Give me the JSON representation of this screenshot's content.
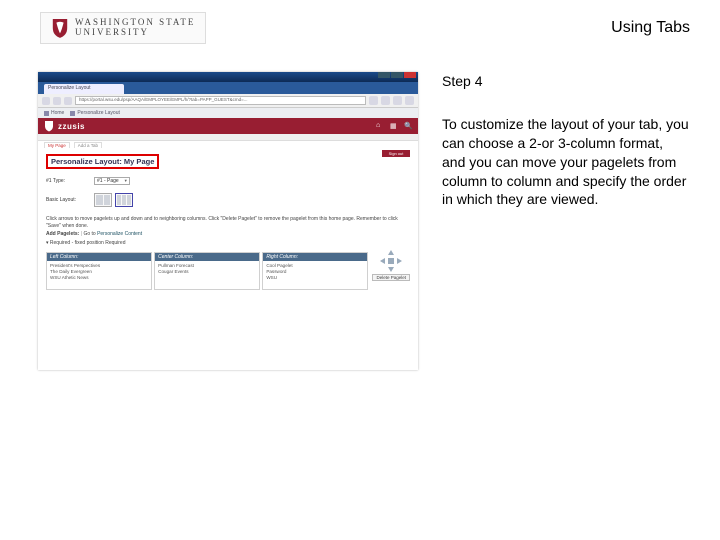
{
  "header": {
    "uni_line1": "WASHINGTON STATE",
    "uni_line2": "UNIVERSITY",
    "page_title": "Using Tabs"
  },
  "instruction": {
    "step": "Step 4",
    "body": "To customize the layout of your tab, you can choose a 2-or 3-column format, and you can move your pagelets from column to column and specify the order in which they are viewed."
  },
  "shot": {
    "browser_tab": "Personalize Layout",
    "url": "https://portal.wsu.edu/psp/AAQA/EMPLOYEE/EMPL/h/?tab=PAPP_GUEST&cmd=...",
    "bookmark1": "Home",
    "bookmark2": "Personalize Layout",
    "brand": "zzusis",
    "signout": "Sign out",
    "nav_tab1": "My Page",
    "nav_tab2": "Add a Tab",
    "heading": "Personalize Layout: My Page",
    "lbl_type": "#1  Type:",
    "val_type": "#1 - Page",
    "lbl_layout": "Basic Layout:",
    "blurb1": "Click arrows to move pagelets up and down and to neighboring columns. Click \"Delete Pagelet\" to remove the pagelet from this home page. Remember to click \"Save\" when done.",
    "blurb2_lead": "Add Pagelets:",
    "blurb2_go": "Go to",
    "blurb2_link": "Personalize Content",
    "blurb3": "▾  Required - fixed position  Required",
    "col1_h": "Left Column:",
    "col2_h": "Center Column:",
    "col3_h": "Right Column:",
    "col1_items": [
      "President's Perspectives",
      "The Daily Evergreen",
      "WSU Athetic News"
    ],
    "col2_items": [
      "Pullman Forecast",
      "Cougar Events"
    ],
    "col3_items": [
      "Cool Pagelet",
      "Password",
      "WSU"
    ],
    "delete_btn": "Delete Pagelet"
  }
}
